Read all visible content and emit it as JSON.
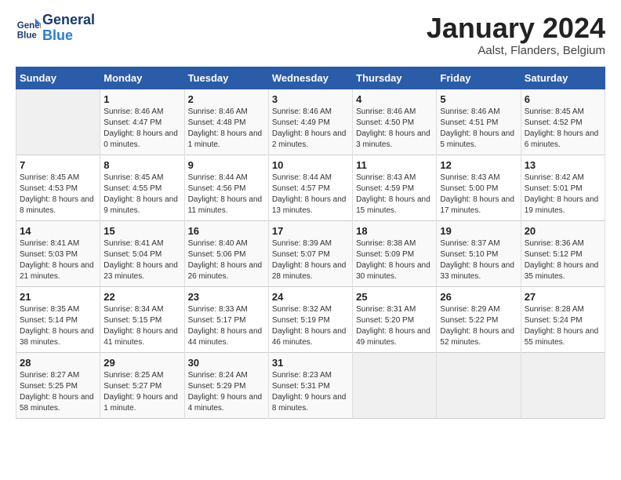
{
  "header": {
    "logo_line1": "General",
    "logo_line2": "Blue",
    "month": "January 2024",
    "location": "Aalst, Flanders, Belgium"
  },
  "days_of_week": [
    "Sunday",
    "Monday",
    "Tuesday",
    "Wednesday",
    "Thursday",
    "Friday",
    "Saturday"
  ],
  "weeks": [
    [
      {
        "num": "",
        "sunrise": "",
        "sunset": "",
        "daylight": ""
      },
      {
        "num": "1",
        "sunrise": "Sunrise: 8:46 AM",
        "sunset": "Sunset: 4:47 PM",
        "daylight": "Daylight: 8 hours and 0 minutes."
      },
      {
        "num": "2",
        "sunrise": "Sunrise: 8:46 AM",
        "sunset": "Sunset: 4:48 PM",
        "daylight": "Daylight: 8 hours and 1 minute."
      },
      {
        "num": "3",
        "sunrise": "Sunrise: 8:46 AM",
        "sunset": "Sunset: 4:49 PM",
        "daylight": "Daylight: 8 hours and 2 minutes."
      },
      {
        "num": "4",
        "sunrise": "Sunrise: 8:46 AM",
        "sunset": "Sunset: 4:50 PM",
        "daylight": "Daylight: 8 hours and 3 minutes."
      },
      {
        "num": "5",
        "sunrise": "Sunrise: 8:46 AM",
        "sunset": "Sunset: 4:51 PM",
        "daylight": "Daylight: 8 hours and 5 minutes."
      },
      {
        "num": "6",
        "sunrise": "Sunrise: 8:45 AM",
        "sunset": "Sunset: 4:52 PM",
        "daylight": "Daylight: 8 hours and 6 minutes."
      }
    ],
    [
      {
        "num": "7",
        "sunrise": "Sunrise: 8:45 AM",
        "sunset": "Sunset: 4:53 PM",
        "daylight": "Daylight: 8 hours and 8 minutes."
      },
      {
        "num": "8",
        "sunrise": "Sunrise: 8:45 AM",
        "sunset": "Sunset: 4:55 PM",
        "daylight": "Daylight: 8 hours and 9 minutes."
      },
      {
        "num": "9",
        "sunrise": "Sunrise: 8:44 AM",
        "sunset": "Sunset: 4:56 PM",
        "daylight": "Daylight: 8 hours and 11 minutes."
      },
      {
        "num": "10",
        "sunrise": "Sunrise: 8:44 AM",
        "sunset": "Sunset: 4:57 PM",
        "daylight": "Daylight: 8 hours and 13 minutes."
      },
      {
        "num": "11",
        "sunrise": "Sunrise: 8:43 AM",
        "sunset": "Sunset: 4:59 PM",
        "daylight": "Daylight: 8 hours and 15 minutes."
      },
      {
        "num": "12",
        "sunrise": "Sunrise: 8:43 AM",
        "sunset": "Sunset: 5:00 PM",
        "daylight": "Daylight: 8 hours and 17 minutes."
      },
      {
        "num": "13",
        "sunrise": "Sunrise: 8:42 AM",
        "sunset": "Sunset: 5:01 PM",
        "daylight": "Daylight: 8 hours and 19 minutes."
      }
    ],
    [
      {
        "num": "14",
        "sunrise": "Sunrise: 8:41 AM",
        "sunset": "Sunset: 5:03 PM",
        "daylight": "Daylight: 8 hours and 21 minutes."
      },
      {
        "num": "15",
        "sunrise": "Sunrise: 8:41 AM",
        "sunset": "Sunset: 5:04 PM",
        "daylight": "Daylight: 8 hours and 23 minutes."
      },
      {
        "num": "16",
        "sunrise": "Sunrise: 8:40 AM",
        "sunset": "Sunset: 5:06 PM",
        "daylight": "Daylight: 8 hours and 26 minutes."
      },
      {
        "num": "17",
        "sunrise": "Sunrise: 8:39 AM",
        "sunset": "Sunset: 5:07 PM",
        "daylight": "Daylight: 8 hours and 28 minutes."
      },
      {
        "num": "18",
        "sunrise": "Sunrise: 8:38 AM",
        "sunset": "Sunset: 5:09 PM",
        "daylight": "Daylight: 8 hours and 30 minutes."
      },
      {
        "num": "19",
        "sunrise": "Sunrise: 8:37 AM",
        "sunset": "Sunset: 5:10 PM",
        "daylight": "Daylight: 8 hours and 33 minutes."
      },
      {
        "num": "20",
        "sunrise": "Sunrise: 8:36 AM",
        "sunset": "Sunset: 5:12 PM",
        "daylight": "Daylight: 8 hours and 35 minutes."
      }
    ],
    [
      {
        "num": "21",
        "sunrise": "Sunrise: 8:35 AM",
        "sunset": "Sunset: 5:14 PM",
        "daylight": "Daylight: 8 hours and 38 minutes."
      },
      {
        "num": "22",
        "sunrise": "Sunrise: 8:34 AM",
        "sunset": "Sunset: 5:15 PM",
        "daylight": "Daylight: 8 hours and 41 minutes."
      },
      {
        "num": "23",
        "sunrise": "Sunrise: 8:33 AM",
        "sunset": "Sunset: 5:17 PM",
        "daylight": "Daylight: 8 hours and 44 minutes."
      },
      {
        "num": "24",
        "sunrise": "Sunrise: 8:32 AM",
        "sunset": "Sunset: 5:19 PM",
        "daylight": "Daylight: 8 hours and 46 minutes."
      },
      {
        "num": "25",
        "sunrise": "Sunrise: 8:31 AM",
        "sunset": "Sunset: 5:20 PM",
        "daylight": "Daylight: 8 hours and 49 minutes."
      },
      {
        "num": "26",
        "sunrise": "Sunrise: 8:29 AM",
        "sunset": "Sunset: 5:22 PM",
        "daylight": "Daylight: 8 hours and 52 minutes."
      },
      {
        "num": "27",
        "sunrise": "Sunrise: 8:28 AM",
        "sunset": "Sunset: 5:24 PM",
        "daylight": "Daylight: 8 hours and 55 minutes."
      }
    ],
    [
      {
        "num": "28",
        "sunrise": "Sunrise: 8:27 AM",
        "sunset": "Sunset: 5:25 PM",
        "daylight": "Daylight: 8 hours and 58 minutes."
      },
      {
        "num": "29",
        "sunrise": "Sunrise: 8:25 AM",
        "sunset": "Sunset: 5:27 PM",
        "daylight": "Daylight: 9 hours and 1 minute."
      },
      {
        "num": "30",
        "sunrise": "Sunrise: 8:24 AM",
        "sunset": "Sunset: 5:29 PM",
        "daylight": "Daylight: 9 hours and 4 minutes."
      },
      {
        "num": "31",
        "sunrise": "Sunrise: 8:23 AM",
        "sunset": "Sunset: 5:31 PM",
        "daylight": "Daylight: 9 hours and 8 minutes."
      },
      {
        "num": "",
        "sunrise": "",
        "sunset": "",
        "daylight": ""
      },
      {
        "num": "",
        "sunrise": "",
        "sunset": "",
        "daylight": ""
      },
      {
        "num": "",
        "sunrise": "",
        "sunset": "",
        "daylight": ""
      }
    ]
  ]
}
